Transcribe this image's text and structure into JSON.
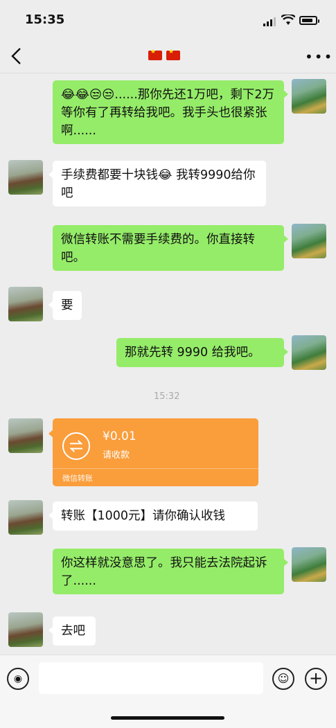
{
  "status": {
    "time": "15:35"
  },
  "nav": {
    "back_glyph": "‹",
    "more_glyph": "•••"
  },
  "messages": {
    "m1": "😂😂😒😒......那你先还1万吧，剩下2万等你有了再转给我吧。我手头也很紧张啊......",
    "m2": "手续费都要十块钱😂 我转9990给你吧",
    "m3": "微信转账不需要手续费的。你直接转吧。",
    "m4": "要",
    "m5": "那就先转 9990 给我吧。",
    "ts": "15:32",
    "m7": "转账【1000元】请你确认收钱",
    "m8": "你这样就没意思了。我只能去法院起诉了......",
    "m9": "去吧"
  },
  "transfer": {
    "amount": "¥0.01",
    "status": "请收款",
    "footer": "微信转账",
    "icon": "transfer-arrows-icon"
  },
  "input": {
    "placeholder": ""
  },
  "colors": {
    "my_bubble": "#95ec69",
    "other_bubble": "#ffffff",
    "transfer_card": "#fa9d3b",
    "background": "#ededed"
  }
}
